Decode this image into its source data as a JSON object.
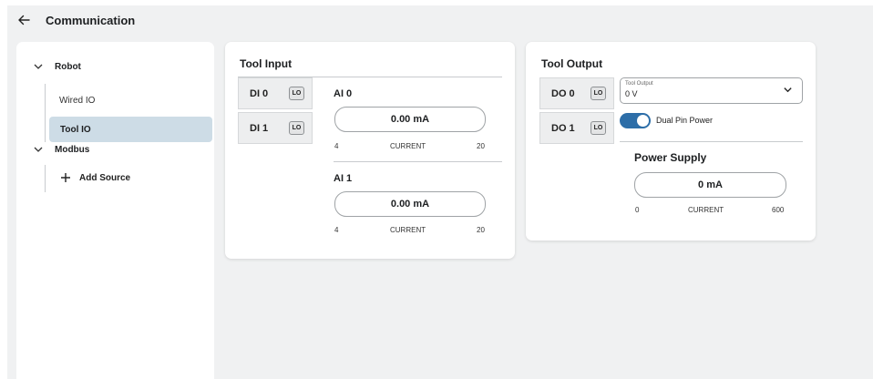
{
  "header": {
    "title": "Communication",
    "back_icon": "arrow-left-icon"
  },
  "sidebar": {
    "groups": [
      {
        "label": "Robot",
        "items": [
          {
            "label": "Wired IO",
            "selected": false
          },
          {
            "label": "Tool IO",
            "selected": true
          }
        ]
      },
      {
        "label": "Modbus",
        "items": [
          {
            "label": "Add Source",
            "icon": "plus-icon"
          }
        ]
      }
    ]
  },
  "tool_input": {
    "title": "Tool Input",
    "digital": [
      {
        "label": "DI 0",
        "state": "LO"
      },
      {
        "label": "DI 1",
        "state": "LO"
      }
    ],
    "analog": [
      {
        "label": "AI 0",
        "value": "0.00 mA",
        "min": "4",
        "mode": "CURRENT",
        "max": "20"
      },
      {
        "label": "AI 1",
        "value": "0.00 mA",
        "min": "4",
        "mode": "CURRENT",
        "max": "20"
      }
    ]
  },
  "tool_output": {
    "title": "Tool Output",
    "digital": [
      {
        "label": "DO 0",
        "state": "LO"
      },
      {
        "label": "DO 1",
        "state": "LO"
      }
    ],
    "select": {
      "label": "Tool Output",
      "value": "0 V"
    },
    "toggle": {
      "label": "Dual Pin Power",
      "on": true
    },
    "power_supply": {
      "title": "Power Supply",
      "value": "0 mA",
      "min": "0",
      "mode": "CURRENT",
      "max": "600"
    }
  },
  "colors": {
    "accent": "#2d6ea8",
    "selected_bg": "#cddce6",
    "background": "#f0f1f2"
  }
}
